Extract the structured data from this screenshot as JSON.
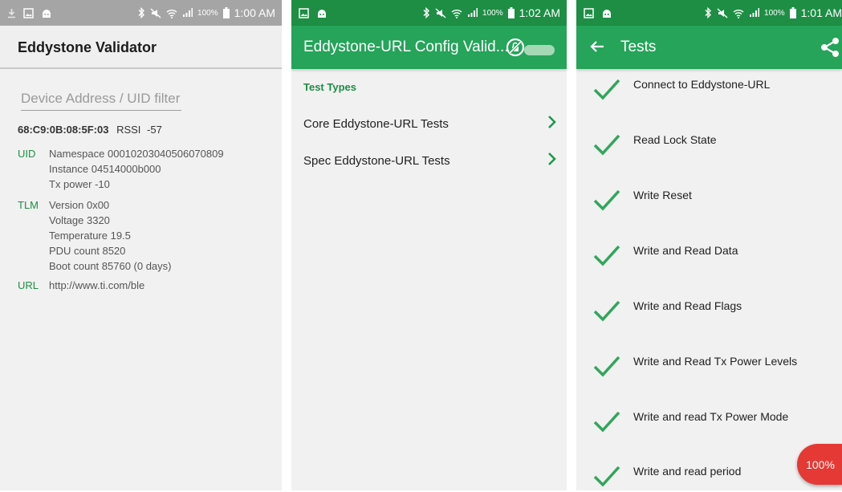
{
  "colors": {
    "green": "#25a45a",
    "dark_green": "#1e8e45",
    "fab_red": "#e53935",
    "status_gray": "#a5a5a5"
  },
  "panel1": {
    "status": {
      "time": "1:00 AM",
      "battery": "100%"
    },
    "title": "Eddystone Validator",
    "filter_placeholder": "Device Address / UID filter",
    "device": {
      "address": "68:C9:0B:08:5F:03",
      "rssi_label": "RSSI",
      "rssi": "-57"
    },
    "frames": {
      "uid": {
        "tag": "UID",
        "lines": [
          "Namespace  00010203040506070809",
          "Instance  04514000b000",
          "Tx power  -10"
        ]
      },
      "tlm": {
        "tag": "TLM",
        "lines": [
          "Version  0x00",
          "Voltage  3320",
          "Temperature  19.5",
          "PDU count  8520",
          "Boot count  85760 (0 days)"
        ]
      },
      "url": {
        "tag": "URL",
        "lines": [
          "http://www.ti.com/ble"
        ]
      }
    }
  },
  "panel2": {
    "status": {
      "time": "1:02 AM",
      "battery": "100%"
    },
    "title": "Eddystone-URL Config Valid...",
    "section": "Test Types",
    "items": [
      {
        "label": "Core Eddystone-URL Tests"
      },
      {
        "label": "Spec Eddystone-URL Tests"
      }
    ]
  },
  "panel3": {
    "status": {
      "time": "1:01 AM",
      "battery": "100%"
    },
    "title": "Tests",
    "tests": [
      {
        "label": "Connect to Eddystone-URL"
      },
      {
        "label": "Read Lock State"
      },
      {
        "label": "Write Reset"
      },
      {
        "label": "Write and Read Data"
      },
      {
        "label": "Write and Read Flags"
      },
      {
        "label": "Write and Read Tx Power Levels"
      },
      {
        "label": "Write and read Tx Power Mode"
      },
      {
        "label": "Write and read period"
      }
    ],
    "fab": "100%"
  }
}
